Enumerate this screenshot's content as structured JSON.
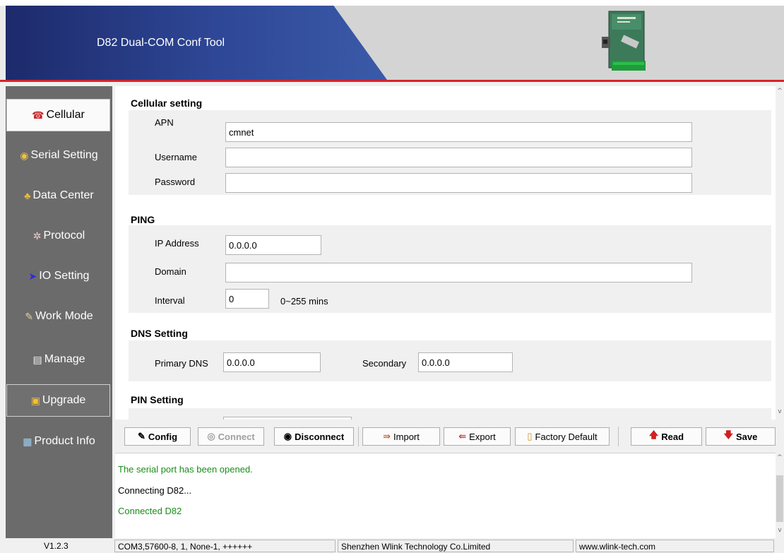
{
  "app": {
    "title": "D82 Dual-COM Conf Tool"
  },
  "sidebar": {
    "items": [
      {
        "label": "Cellular",
        "icon": "phone-icon"
      },
      {
        "label": "Serial Setting",
        "icon": "serial-icon"
      },
      {
        "label": "Data Center",
        "icon": "data-center-icon"
      },
      {
        "label": "Protocol",
        "icon": "protocol-icon"
      },
      {
        "label": "IO Setting",
        "icon": "arrow-right-icon"
      },
      {
        "label": "Work Mode",
        "icon": "work-mode-icon"
      },
      {
        "label": "Manage",
        "icon": "manage-icon"
      },
      {
        "label": "Upgrade",
        "icon": "upgrade-icon"
      },
      {
        "label": "Product Info",
        "icon": "product-info-icon"
      }
    ]
  },
  "cellular": {
    "title": "Cellular setting",
    "apn_label": "APN",
    "apn_value": "cmnet",
    "username_label": "Username",
    "username_value": "",
    "password_label": "Password",
    "password_value": ""
  },
  "ping": {
    "title": "PING",
    "ip_label": "IP Address",
    "ip_value": "0.0.0.0",
    "domain_label": "Domain",
    "domain_value": "",
    "interval_label": "Interval",
    "interval_value": "0",
    "interval_hint": "0~255 mins"
  },
  "dns": {
    "title": "DNS Setting",
    "primary_label": "Primary DNS",
    "primary_value": "0.0.0.0",
    "secondary_label": "Secondary",
    "secondary_value": "0.0.0.0"
  },
  "pin": {
    "title": "PIN Setting"
  },
  "toolbar": {
    "config": "Config",
    "connect": "Connect",
    "disconnect": "Disconnect",
    "import": "Import",
    "export": "Export",
    "factory_default": "Factory Default",
    "read": "Read",
    "save": "Save"
  },
  "log": {
    "lines": [
      {
        "text": "The serial port has been opened.",
        "color": "#1a8c1a"
      },
      {
        "text": "Connecting D82...",
        "color": "#000000"
      },
      {
        "text": "Connected D82",
        "color": "#1a8c1a"
      }
    ]
  },
  "status": {
    "version": "V1.2.3",
    "port": "COM3,57600-8, 1, None-1, ++++++",
    "company": "Shenzhen Wlink Technology Co.Limited",
    "website": "www.wlink-tech.com"
  },
  "colors": {
    "accent_red": "#d9232a",
    "header_blue": "#2e4796",
    "sidebar_gray": "#6b6b6b",
    "log_green": "#1a8c1a"
  }
}
